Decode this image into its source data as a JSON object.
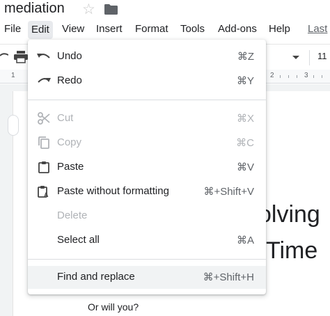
{
  "doc": {
    "title": "mediation"
  },
  "menubar": {
    "items": [
      "File",
      "Edit",
      "View",
      "Insert",
      "Format",
      "Tools",
      "Add-ons",
      "Help"
    ],
    "last_edit": "Last"
  },
  "toolbar": {
    "font_size": "11"
  },
  "ruler": {
    "marks": [
      "1",
      "1",
      "2",
      "3"
    ]
  },
  "document": {
    "heading_line1": "olving",
    "heading_line2": "Time",
    "body_line": "Or will you?"
  },
  "edit_menu": {
    "items": [
      {
        "label": "Undo",
        "shortcut": "⌘Z",
        "icon": "undo-icon",
        "enabled": true
      },
      {
        "label": "Redo",
        "shortcut": "⌘Y",
        "icon": "redo-icon",
        "enabled": true
      },
      {
        "label": "Cut",
        "shortcut": "⌘X",
        "icon": "scissors-icon",
        "enabled": false
      },
      {
        "label": "Copy",
        "shortcut": "⌘C",
        "icon": "copy-icon",
        "enabled": false
      },
      {
        "label": "Paste",
        "shortcut": "⌘V",
        "icon": "clipboard-icon",
        "enabled": true
      },
      {
        "label": "Paste without formatting",
        "shortcut": "⌘+Shift+V",
        "icon": "clipboard-text-icon",
        "enabled": true
      },
      {
        "label": "Delete",
        "shortcut": "",
        "icon": "",
        "enabled": false
      },
      {
        "label": "Select all",
        "shortcut": "⌘A",
        "icon": "",
        "enabled": true
      },
      {
        "label": "Find and replace",
        "shortcut": "⌘+Shift+H",
        "icon": "",
        "enabled": true,
        "highlighted": true
      }
    ]
  }
}
